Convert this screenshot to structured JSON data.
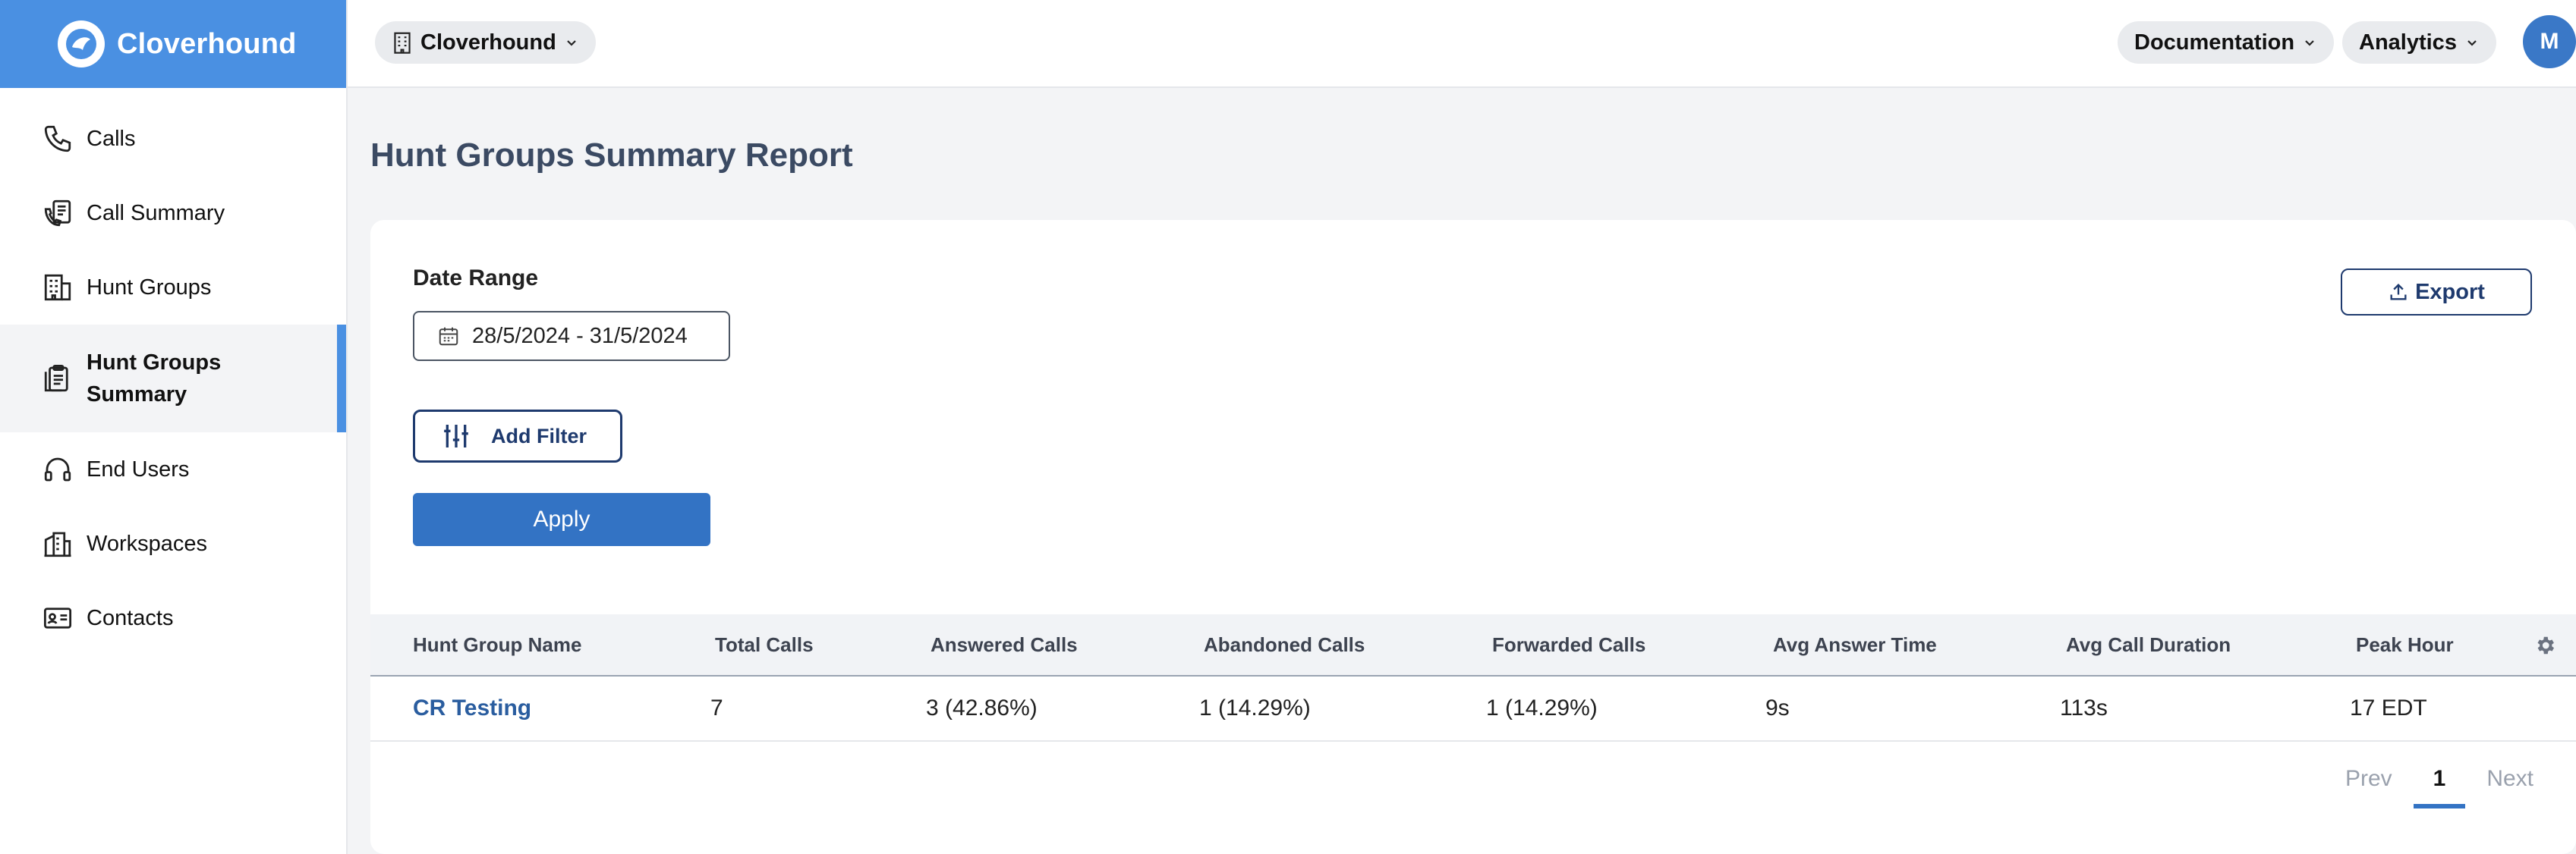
{
  "brand": {
    "name": "Cloverhound"
  },
  "sidebar": {
    "items": [
      {
        "label": "Calls",
        "icon": "phone-icon"
      },
      {
        "label": "Call Summary",
        "icon": "call-summary-icon"
      },
      {
        "label": "Hunt Groups",
        "icon": "building-icon"
      },
      {
        "label": "Hunt Groups Summary",
        "icon": "clipboard-icon",
        "active": true
      },
      {
        "label": "End Users",
        "icon": "headset-icon"
      },
      {
        "label": "Workspaces",
        "icon": "workspace-icon"
      },
      {
        "label": "Contacts",
        "icon": "contact-card-icon"
      }
    ]
  },
  "topbar": {
    "org": "Cloverhound",
    "docs": "Documentation",
    "analytics": "Analytics",
    "avatar": "M"
  },
  "page": {
    "title": "Hunt Groups Summary Report",
    "date_range_label": "Date Range",
    "date_range_value": "28/5/2024 - 31/5/2024",
    "add_filter": "Add Filter",
    "apply": "Apply",
    "export": "Export"
  },
  "table": {
    "columns": [
      "Hunt Group Name",
      "Total Calls",
      "Answered Calls",
      "Abandoned Calls",
      "Forwarded Calls",
      "Avg Answer Time",
      "Avg Call Duration",
      "Peak Hour"
    ],
    "rows": [
      [
        "CR Testing",
        "7",
        "3 (42.86%)",
        "1 (14.29%)",
        "1 (14.29%)",
        "9s",
        "113s",
        "17 EDT"
      ]
    ]
  },
  "pagination": {
    "prev": "Prev",
    "page": "1",
    "next": "Next"
  },
  "colors": {
    "brand": "#4a90e2",
    "primary": "#3373c4",
    "navy": "#1e3a6e"
  }
}
